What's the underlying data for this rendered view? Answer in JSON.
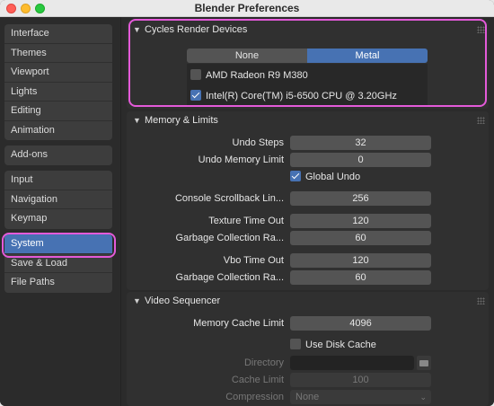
{
  "window": {
    "title": "Blender Preferences"
  },
  "sidebar": {
    "groups": [
      [
        "Interface",
        "Themes",
        "Viewport",
        "Lights",
        "Editing",
        "Animation"
      ],
      [
        "Add-ons"
      ],
      [
        "Input",
        "Navigation",
        "Keymap"
      ],
      [
        "System",
        "Save & Load",
        "File Paths"
      ]
    ],
    "active": "System"
  },
  "cycles": {
    "header": "Cycles Render Devices",
    "tabs": [
      "None",
      "Metal"
    ],
    "active_tab": "Metal",
    "devices": [
      {
        "label": "AMD Radeon R9 M380",
        "checked": false
      },
      {
        "label": "Intel(R) Core(TM) i5-6500 CPU @ 3.20GHz",
        "checked": true
      }
    ]
  },
  "memory": {
    "header": "Memory & Limits",
    "undo_steps_label": "Undo Steps",
    "undo_steps": "32",
    "undo_mem_label": "Undo Memory Limit",
    "undo_mem": "0",
    "global_undo_label": "Global Undo",
    "global_undo": true,
    "console_label": "Console Scrollback Lin...",
    "console": "256",
    "tex_timeout_label": "Texture Time Out",
    "tex_timeout": "120",
    "gc_label_1": "Garbage Collection Ra...",
    "gc_1": "60",
    "vbo_label": "Vbo Time Out",
    "vbo": "120",
    "gc_label_2": "Garbage Collection Ra...",
    "gc_2": "60"
  },
  "video": {
    "header": "Video Sequencer",
    "mem_cache_label": "Memory Cache Limit",
    "mem_cache": "4096",
    "disk_cache_label": "Use Disk Cache",
    "disk_cache": false,
    "directory_label": "Directory",
    "cache_limit_label": "Cache Limit",
    "cache_limit": "100",
    "compression_label": "Compression",
    "compression": "None"
  },
  "colors": {
    "accent": "#4772b3",
    "highlight": "#e45ad9"
  }
}
